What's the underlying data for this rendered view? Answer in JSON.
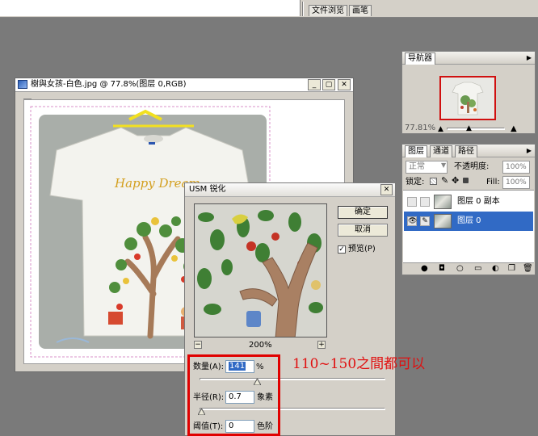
{
  "workspace_tabs": [
    "文件浏览",
    "画笔"
  ],
  "navigator": {
    "title": "导航器",
    "zoom": "77.81%"
  },
  "layers_panel": {
    "tabs": [
      "图层",
      "通道",
      "路径"
    ],
    "blend_mode": "正常",
    "opacity_label": "不透明度:",
    "opacity_value": "100%",
    "lock_label": "锁定:",
    "fill_label": "Fill:",
    "fill_value": "100%",
    "layers": [
      {
        "name": "图层 0 副本",
        "selected": false
      },
      {
        "name": "图层 0",
        "selected": true
      }
    ]
  },
  "document": {
    "title": "樹與女孩-白色.jpg @ 77.8%(图层 0,RGB)",
    "image_text": "Happy Dream"
  },
  "usm_dialog": {
    "title": "USM 锐化",
    "ok_label": "确定",
    "cancel_label": "取消",
    "preview_label": "预览(P)",
    "preview_checked": true,
    "zoom_label": "200%",
    "amount_label": "数量(A):",
    "amount_value": "141",
    "amount_unit": "%",
    "amount_fraction": 0.31,
    "radius_label": "半径(R):",
    "radius_value": "0.7",
    "radius_unit": "象素",
    "radius_fraction": 0.01,
    "threshold_label": "阈值(T):",
    "threshold_value": "0",
    "threshold_unit": "色阶"
  },
  "annotation": "110~150之間都可以",
  "colors": {
    "workspace": "#7a7a7a",
    "panel": "#d4d0c8",
    "selection": "#316ac5",
    "annotation_red": "#e00000"
  }
}
